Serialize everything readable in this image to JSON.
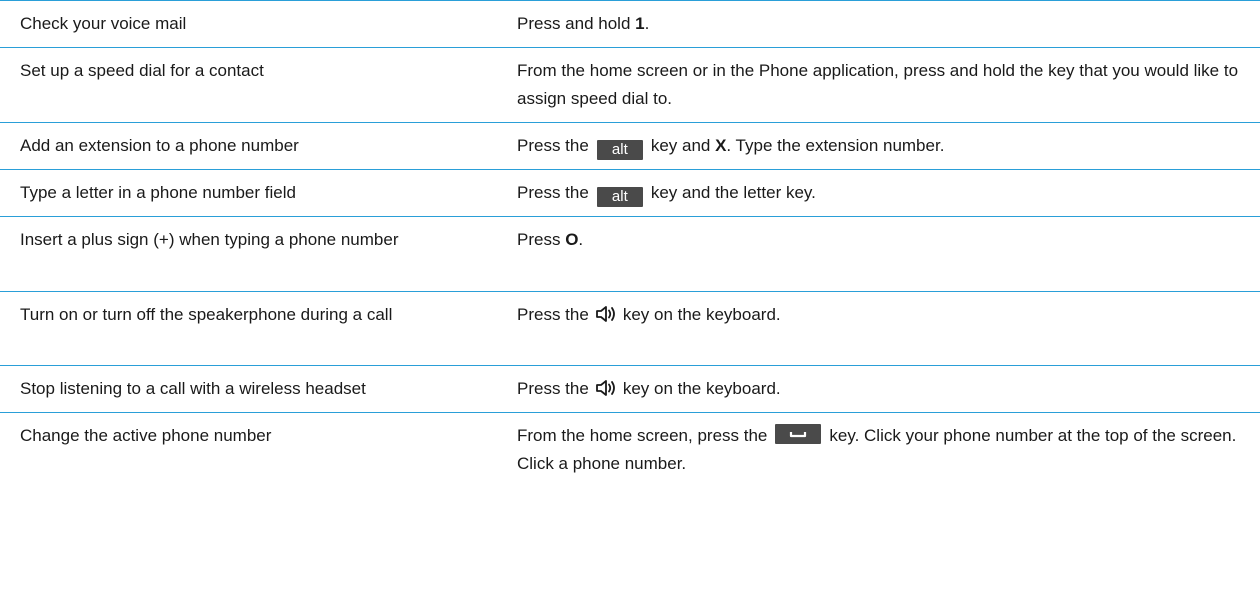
{
  "rows": [
    {
      "action": "Check your voice mail",
      "instr_pre": "Press and hold ",
      "instr_bold": "1",
      "instr_post": "."
    },
    {
      "action": "Set up a speed dial for a contact",
      "instr": "From the home screen or in the Phone application, press and hold the key that you would like to assign speed dial to."
    },
    {
      "action": "Add an extension to a phone number",
      "instr_pre": "Press the",
      "key_label": "alt",
      "instr_mid": "key and ",
      "instr_bold": "X",
      "instr_post": ". Type the extension number."
    },
    {
      "action": "Type a letter in a phone number field",
      "instr_pre": "Press the",
      "key_label": "alt",
      "instr_post": "key and the letter key."
    },
    {
      "action": "Insert a plus sign (+) when typing a phone number",
      "instr_pre": "Press ",
      "instr_bold": "O",
      "instr_post": "."
    },
    {
      "action": "Turn on or turn off the speakerphone during a call",
      "instr_pre": "Press the",
      "icon": "speaker-icon",
      "instr_post": "key on the keyboard."
    },
    {
      "action": "Stop listening to a call with a wireless headset",
      "instr_pre": "Press the",
      "icon": "speaker-icon",
      "instr_post": "key on the keyboard."
    },
    {
      "action": "Change the active phone number",
      "instr_pre": "From the home screen, press the",
      "icon": "send-key-icon",
      "instr_post": "key. Click your phone number at the top of the screen. Click a phone number."
    }
  ],
  "colors": {
    "rule": "#2a9fd8",
    "key_bg": "#4a4a4a"
  }
}
